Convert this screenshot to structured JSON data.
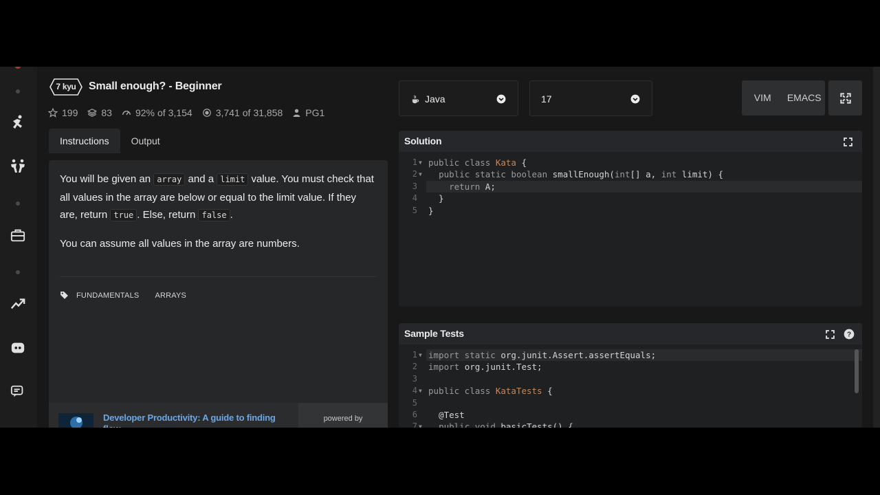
{
  "kata": {
    "rank": "7 kyu",
    "title": "Small enough? - Beginner",
    "stats": {
      "stars": "199",
      "collections": "83",
      "satisfaction": "92%",
      "satisfaction_of": "of",
      "votes": "3,154",
      "completed": "3,741",
      "completed_of": "of",
      "attempts": "31,858",
      "author": "PG1"
    },
    "tabs": [
      "Instructions",
      "Output"
    ],
    "description": {
      "p1_a": "You will be given an ",
      "p1_code1": "array",
      "p1_b": " and a ",
      "p1_code2": "limit",
      "p1_c": " value. You must check that all values in the array are below or equal to the limit value. If they are, return ",
      "p1_code3": "true",
      "p1_d": ". Else, return ",
      "p1_code4": "false",
      "p1_e": ".",
      "p2": "You can assume all values in the array are numbers."
    },
    "tags": [
      "FUNDAMENTALS",
      "ARRAYS"
    ]
  },
  "ad": {
    "text": "Developer Productivity: A guide to finding flow",
    "powered_by": "powered by"
  },
  "toolbar": {
    "language": "Java",
    "version": "17",
    "vim_label": "VIM",
    "emacs_label": "EMACS"
  },
  "solution": {
    "title": "Solution",
    "lines": [
      "1",
      "2",
      "3",
      "4",
      "5"
    ]
  },
  "sample_tests": {
    "title": "Sample Tests",
    "lines": [
      "1",
      "2",
      "3",
      "4",
      "5",
      "6",
      "7"
    ]
  },
  "colors": {
    "accent_link": "#6aa7e8",
    "type_color": "#bf8860",
    "background": "#181818",
    "panel": "#262729"
  }
}
